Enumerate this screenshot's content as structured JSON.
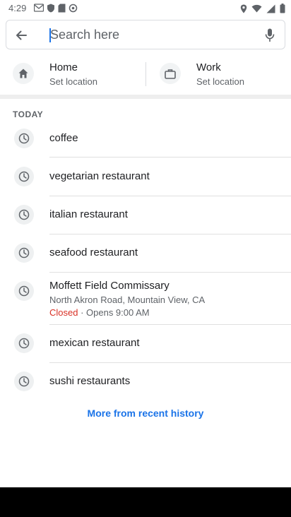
{
  "status_bar": {
    "time": "4:29"
  },
  "search": {
    "placeholder": "Search here",
    "value": ""
  },
  "shortcuts": {
    "home": {
      "title": "Home",
      "subtitle": "Set location"
    },
    "work": {
      "title": "Work",
      "subtitle": "Set location"
    }
  },
  "history": {
    "section_title": "TODAY",
    "items": [
      {
        "label": "coffee"
      },
      {
        "label": "vegetarian restaurant"
      },
      {
        "label": "italian restaurant"
      },
      {
        "label": "seafood restaurant"
      },
      {
        "label": "Moffett Field Commissary",
        "address": "North Akron Road, Mountain View, CA",
        "status": "Closed",
        "hours": " · Opens 9:00 AM"
      },
      {
        "label": "mexican restaurant"
      },
      {
        "label": "sushi restaurants"
      }
    ],
    "more_label": "More from recent history"
  },
  "colors": {
    "accent": "#1a73e8",
    "closed": "#d93025"
  }
}
